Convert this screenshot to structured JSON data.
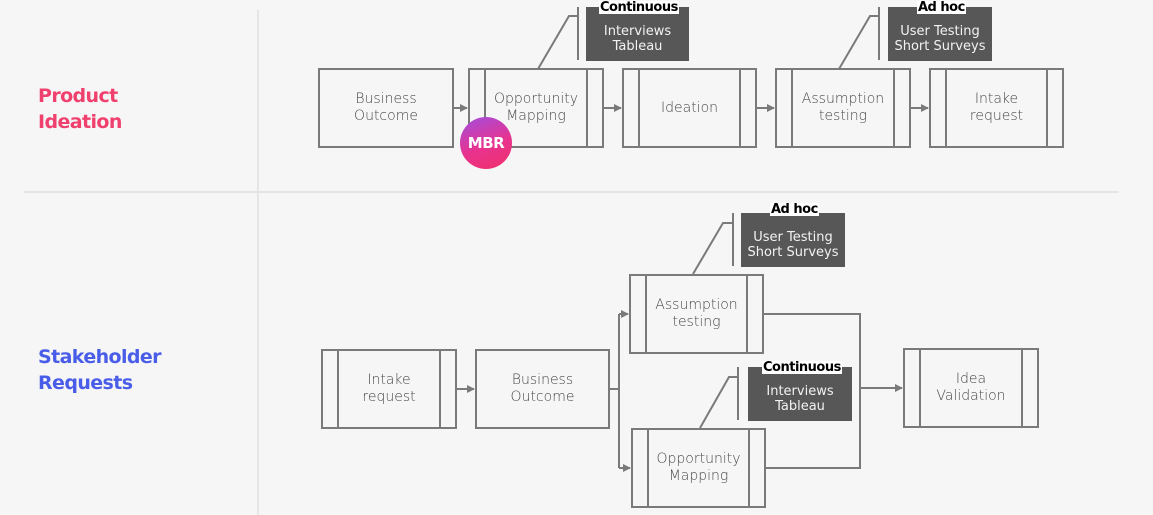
{
  "lanes": [
    {
      "title": "Product\nIdeation",
      "color": "#f0406e"
    },
    {
      "title": "Stakeholder\nRequests",
      "color": "#4a5de8"
    }
  ],
  "product_ideation": {
    "steps": [
      {
        "label": "Business\nOutcome",
        "style": "process"
      },
      {
        "label": "Opportunity\nMapping",
        "style": "subprocess"
      },
      {
        "label": "Ideation",
        "style": "subprocess"
      },
      {
        "label": "Assumption\ntesting",
        "style": "subprocess"
      },
      {
        "label": "Intake\nrequest",
        "style": "subprocess"
      }
    ],
    "badge": "MBR",
    "annotations": [
      {
        "label": "Continuous",
        "text": "Interviews\nTableau",
        "attached_to": "Opportunity Mapping"
      },
      {
        "label": "Ad hoc",
        "text": "User Testing\nShort Surveys",
        "attached_to": "Assumption testing"
      }
    ]
  },
  "stakeholder_requests": {
    "steps": [
      {
        "label": "Intake\nrequest",
        "style": "subprocess"
      },
      {
        "label": "Business\nOutcome",
        "style": "process"
      },
      {
        "label": "Assumption\ntesting",
        "style": "subprocess"
      },
      {
        "label": "Opportunity\nMapping",
        "style": "subprocess"
      },
      {
        "label": "Idea\nValidation",
        "style": "subprocess"
      }
    ],
    "annotations": [
      {
        "label": "Ad hoc",
        "text": "User Testing\nShort Surveys",
        "attached_to": "Assumption testing"
      },
      {
        "label": "Continuous",
        "text": "Interviews\nTableau",
        "attached_to": "Opportunity Mapping"
      }
    ]
  },
  "colors": {
    "stroke": "#7a7a7a",
    "annotation_fill": "#575757",
    "background": "#f6f6f6"
  }
}
